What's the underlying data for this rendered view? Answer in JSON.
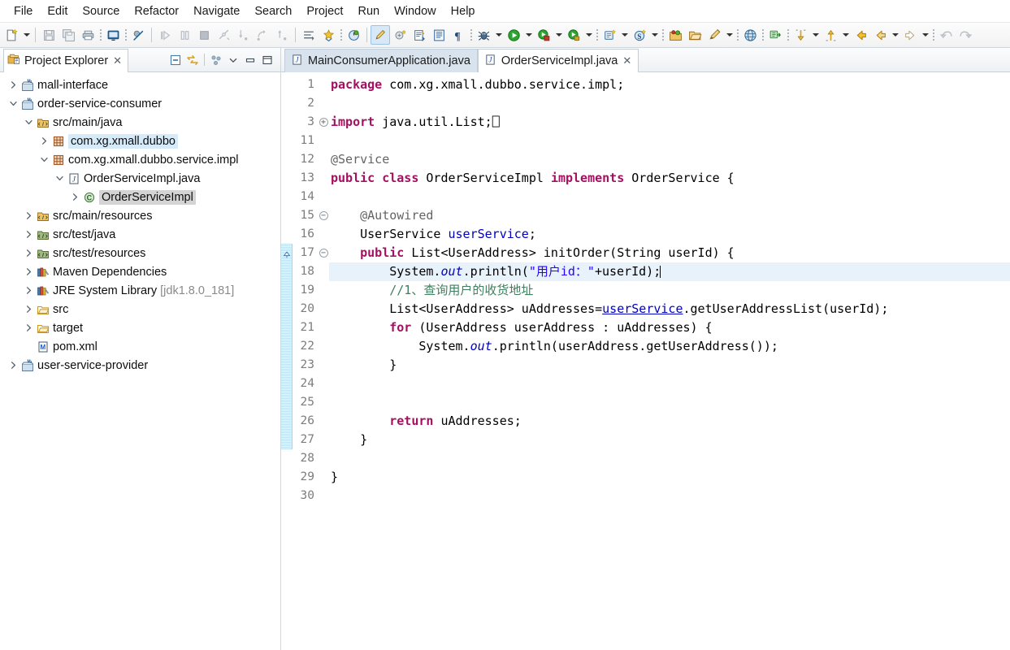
{
  "menu": {
    "items": [
      "File",
      "Edit",
      "Source",
      "Refactor",
      "Navigate",
      "Search",
      "Project",
      "Run",
      "Window",
      "Help"
    ]
  },
  "toolbar": {
    "groups": [
      {
        "items": [
          {
            "name": "new-wizard-icon",
            "kind": "icon"
          },
          {
            "name": "new-dropdown-arrow",
            "kind": "arrow"
          }
        ]
      },
      {
        "items": [
          {
            "name": "save-icon",
            "kind": "icon"
          },
          {
            "name": "save-all-icon",
            "kind": "icon"
          },
          {
            "name": "print-icon",
            "kind": "icon"
          },
          {
            "name": "dots",
            "kind": "dots"
          },
          {
            "name": "open-console-icon",
            "kind": "icon"
          },
          {
            "name": "dots",
            "kind": "dots"
          },
          {
            "name": "skip-breakpoints-icon",
            "kind": "icon"
          }
        ]
      },
      {
        "items": [
          {
            "name": "resume-icon",
            "kind": "icon"
          },
          {
            "name": "suspend-icon",
            "kind": "icon"
          },
          {
            "name": "terminate-icon",
            "kind": "icon"
          },
          {
            "name": "disconnect-icon",
            "kind": "icon"
          },
          {
            "name": "step-into-icon",
            "kind": "icon"
          },
          {
            "name": "step-over-icon",
            "kind": "icon"
          },
          {
            "name": "step-return-icon",
            "kind": "icon"
          }
        ]
      },
      {
        "items": [
          {
            "name": "next-annotation-icon",
            "kind": "icon"
          },
          {
            "name": "coverage-icon",
            "kind": "icon"
          },
          {
            "name": "dots",
            "kind": "dots"
          },
          {
            "name": "profile-icon",
            "kind": "icon"
          }
        ]
      },
      {
        "items": [
          {
            "name": "edit-icon",
            "kind": "icon",
            "active": true
          },
          {
            "name": "new-java-class-icon",
            "kind": "icon"
          },
          {
            "name": "new-java-package-icon",
            "kind": "icon"
          },
          {
            "name": "open-type-icon",
            "kind": "icon"
          },
          {
            "name": "show-whitespace-icon",
            "kind": "icon"
          },
          {
            "name": "dots",
            "kind": "dots"
          },
          {
            "name": "debug-icon",
            "kind": "icon"
          },
          {
            "name": "debug-dropdown-arrow",
            "kind": "arrow"
          },
          {
            "name": "run-icon",
            "kind": "icon"
          },
          {
            "name": "run-dropdown-arrow",
            "kind": "arrow"
          },
          {
            "name": "run-as-server-icon",
            "kind": "icon"
          },
          {
            "name": "run-as-server-arrow",
            "kind": "arrow"
          },
          {
            "name": "run-as-external-icon",
            "kind": "icon"
          },
          {
            "name": "run-as-external-arrow",
            "kind": "arrow"
          },
          {
            "name": "dots",
            "kind": "dots"
          },
          {
            "name": "new-run-config-icon",
            "kind": "icon"
          },
          {
            "name": "new-run-config-arrow",
            "kind": "arrow"
          },
          {
            "name": "svn-icon",
            "kind": "icon"
          },
          {
            "name": "svn-dropdown-arrow",
            "kind": "arrow"
          },
          {
            "name": "dots",
            "kind": "dots"
          },
          {
            "name": "open-perspective-icon",
            "kind": "icon"
          },
          {
            "name": "open-resource-icon",
            "kind": "icon"
          },
          {
            "name": "search-icon",
            "kind": "icon"
          },
          {
            "name": "search-dropdown-arrow",
            "kind": "arrow"
          },
          {
            "name": "dots",
            "kind": "dots"
          },
          {
            "name": "web-browser-icon",
            "kind": "icon"
          },
          {
            "name": "dots",
            "kind": "dots"
          },
          {
            "name": "pin-editor-icon",
            "kind": "icon"
          },
          {
            "name": "dots",
            "kind": "dots"
          },
          {
            "name": "next-member-icon",
            "kind": "icon"
          },
          {
            "name": "next-member-arrow",
            "kind": "arrow"
          },
          {
            "name": "previous-member-icon",
            "kind": "icon"
          },
          {
            "name": "previous-member-arrow",
            "kind": "arrow"
          },
          {
            "name": "back-icon",
            "kind": "icon"
          },
          {
            "name": "back-history-icon",
            "kind": "icon"
          },
          {
            "name": "back-history-arrow",
            "kind": "arrow"
          },
          {
            "name": "forward-icon",
            "kind": "icon"
          },
          {
            "name": "forward-arrow",
            "kind": "arrow"
          },
          {
            "name": "dots",
            "kind": "dots"
          },
          {
            "name": "undo-icon",
            "kind": "icon"
          },
          {
            "name": "redo-icon",
            "kind": "icon"
          }
        ]
      }
    ]
  },
  "explorer": {
    "title": "Project Explorer",
    "close_label": "✕",
    "tools": [
      {
        "name": "collapse-all-icon"
      },
      {
        "name": "link-with-editor-icon"
      },
      {
        "name": "view-menu-icon"
      },
      {
        "name": "minimize-view-icon"
      },
      {
        "name": "maximize-view-icon"
      }
    ],
    "tree": [
      {
        "label": "mall-interface",
        "indent": 0,
        "twisty": "collapsed",
        "icon": "maven-project-icon"
      },
      {
        "label": "order-service-consumer",
        "indent": 0,
        "twisty": "expanded",
        "icon": "maven-project-icon"
      },
      {
        "label": "src/main/java",
        "indent": 1,
        "twisty": "expanded",
        "icon": "source-folder-icon"
      },
      {
        "label": "com.xg.xmall.dubbo",
        "indent": 2,
        "twisty": "collapsed",
        "icon": "package-icon",
        "highlight": "blue"
      },
      {
        "label": "com.xg.xmall.dubbo.service.impl",
        "indent": 2,
        "twisty": "expanded",
        "icon": "package-icon"
      },
      {
        "label": "OrderServiceImpl.java",
        "indent": 3,
        "twisty": "expanded",
        "icon": "java-file-icon"
      },
      {
        "label": "OrderServiceImpl",
        "indent": 4,
        "twisty": "collapsed",
        "icon": "java-class-icon",
        "highlight": "gray"
      },
      {
        "label": "src/main/resources",
        "indent": 1,
        "twisty": "collapsed",
        "icon": "source-folder-icon"
      },
      {
        "label": "src/test/java",
        "indent": 1,
        "twisty": "collapsed",
        "icon": "source-folder-excluded-icon"
      },
      {
        "label": "src/test/resources",
        "indent": 1,
        "twisty": "collapsed",
        "icon": "source-folder-excluded-icon"
      },
      {
        "label": "Maven Dependencies",
        "indent": 1,
        "twisty": "collapsed",
        "icon": "library-icon"
      },
      {
        "label": "JRE System Library",
        "indent": 1,
        "twisty": "collapsed",
        "icon": "library-icon",
        "suffix": "[jdk1.8.0_181]"
      },
      {
        "label": "src",
        "indent": 1,
        "twisty": "collapsed",
        "icon": "folder-icon"
      },
      {
        "label": "target",
        "indent": 1,
        "twisty": "collapsed",
        "icon": "folder-icon"
      },
      {
        "label": "pom.xml",
        "indent": 1,
        "twisty": "none",
        "icon": "xml-file-icon"
      },
      {
        "label": "user-service-provider",
        "indent": 0,
        "twisty": "collapsed",
        "icon": "maven-project-icon"
      }
    ]
  },
  "editor": {
    "tabs": [
      {
        "label": "MainConsumerApplication.java",
        "active": false,
        "icon": "java-file-icon",
        "closable": false
      },
      {
        "label": "OrderServiceImpl.java",
        "active": true,
        "icon": "java-file-icon",
        "closable": true,
        "close_label": "✕"
      }
    ],
    "current_line": 18,
    "change_bar_lines": [
      17,
      27
    ],
    "fold_markers": [
      {
        "line": 3,
        "state": "collapsed"
      },
      {
        "line": 15,
        "state": "expanded"
      },
      {
        "line": 17,
        "state": "expanded"
      }
    ],
    "override_marker_line": 17,
    "line_numbers": [
      1,
      2,
      3,
      11,
      12,
      13,
      14,
      15,
      16,
      17,
      18,
      19,
      20,
      21,
      22,
      23,
      24,
      25,
      26,
      27,
      28,
      29,
      30
    ],
    "lines": [
      {
        "n": 1,
        "tokens": [
          {
            "t": "package ",
            "c": "kw"
          },
          {
            "t": "com.xg.xmall.dubbo.service.impl;",
            "c": "plain"
          }
        ]
      },
      {
        "n": 2,
        "tokens": []
      },
      {
        "n": 3,
        "tokens": [
          {
            "t": "import ",
            "c": "kw"
          },
          {
            "t": "java.util.List;",
            "c": "plain"
          },
          {
            "t": "⎕",
            "c": "plain"
          }
        ]
      },
      {
        "n": 11,
        "tokens": []
      },
      {
        "n": 12,
        "tokens": [
          {
            "t": "@Service",
            "c": "ann"
          }
        ]
      },
      {
        "n": 13,
        "tokens": [
          {
            "t": "public class ",
            "c": "kw"
          },
          {
            "t": "OrderServiceImpl ",
            "c": "plain"
          },
          {
            "t": "implements ",
            "c": "kw"
          },
          {
            "t": "OrderService {",
            "c": "plain"
          }
        ]
      },
      {
        "n": 14,
        "tokens": []
      },
      {
        "n": 15,
        "tokens": [
          {
            "t": "    @Autowired",
            "c": "ann"
          }
        ]
      },
      {
        "n": 16,
        "tokens": [
          {
            "t": "    UserService ",
            "c": "plain"
          },
          {
            "t": "userService",
            "c": "fld"
          },
          {
            "t": ";",
            "c": "plain"
          }
        ]
      },
      {
        "n": 17,
        "tokens": [
          {
            "t": "    ",
            "c": "plain"
          },
          {
            "t": "public ",
            "c": "kw"
          },
          {
            "t": "List<UserAddress> initOrder(String userId) {",
            "c": "plain"
          }
        ]
      },
      {
        "n": 18,
        "tokens": [
          {
            "t": "        System.",
            "c": "plain"
          },
          {
            "t": "out",
            "c": "stat"
          },
          {
            "t": ".println(",
            "c": "plain"
          },
          {
            "t": "\"用户id：\"",
            "c": "str"
          },
          {
            "t": "+userId);",
            "c": "plain"
          }
        ],
        "cursor": true
      },
      {
        "n": 19,
        "tokens": [
          {
            "t": "        //1、查询用户的收货地址",
            "c": "cmt"
          }
        ]
      },
      {
        "n": 20,
        "tokens": [
          {
            "t": "        List<UserAddress> uAddresses=",
            "c": "plain"
          },
          {
            "t": "userService",
            "c": "fldu"
          },
          {
            "t": ".getUserAddressList(userId);",
            "c": "plain"
          }
        ]
      },
      {
        "n": 21,
        "tokens": [
          {
            "t": "        ",
            "c": "plain"
          },
          {
            "t": "for ",
            "c": "kw"
          },
          {
            "t": "(UserAddress userAddress : uAddresses) {",
            "c": "plain"
          }
        ]
      },
      {
        "n": 22,
        "tokens": [
          {
            "t": "            System.",
            "c": "plain"
          },
          {
            "t": "out",
            "c": "stat"
          },
          {
            "t": ".println(userAddress.getUserAddress());",
            "c": "plain"
          }
        ]
      },
      {
        "n": 23,
        "tokens": [
          {
            "t": "        }",
            "c": "plain"
          }
        ]
      },
      {
        "n": 24,
        "tokens": []
      },
      {
        "n": 25,
        "tokens": []
      },
      {
        "n": 26,
        "tokens": [
          {
            "t": "        ",
            "c": "plain"
          },
          {
            "t": "return ",
            "c": "kw"
          },
          {
            "t": "uAddresses;",
            "c": "plain"
          }
        ]
      },
      {
        "n": 27,
        "tokens": [
          {
            "t": "    }",
            "c": "plain"
          }
        ]
      },
      {
        "n": 28,
        "tokens": []
      },
      {
        "n": 29,
        "tokens": [
          {
            "t": "}",
            "c": "plain"
          }
        ]
      },
      {
        "n": 30,
        "tokens": []
      }
    ]
  },
  "colors": {
    "keyword": "#a31060",
    "string": "#2a00ff",
    "comment": "#3f7f5f",
    "annotation": "#646464",
    "field": "#0000c0",
    "current_line": "#e8f2fb",
    "tree_select": "#d4d4d4",
    "tree_highlight": "#d6ebfa",
    "change_bar": "#bfe3f5"
  }
}
